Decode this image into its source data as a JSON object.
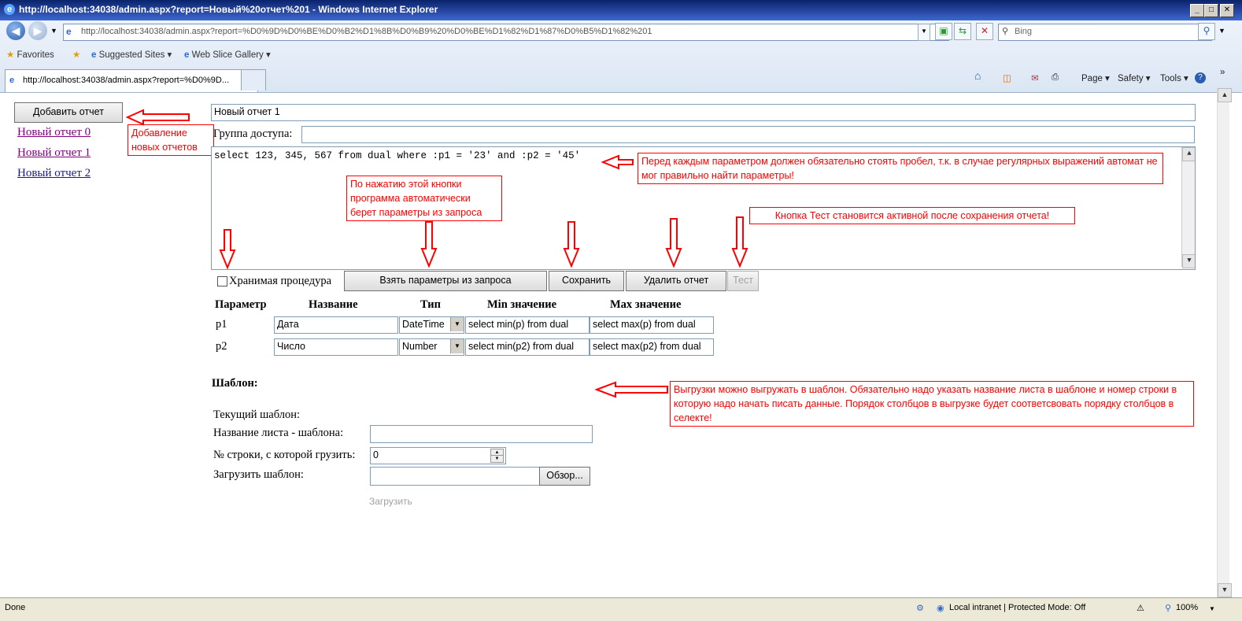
{
  "window": {
    "title": "http://localhost:34038/admin.aspx?report=Новый%20отчет%201 - Windows Internet Explorer"
  },
  "browser": {
    "address": "http://localhost:34038/admin.aspx?report=%D0%9D%D0%BE%D0%B2%D1%8B%D0%B9%20%D0%BE%D1%82%D1%87%D0%B5%D1%82%201",
    "search_placeholder": "Bing",
    "favorites_label": "Favorites",
    "suggested_sites": "Suggested Sites ▾",
    "web_slice": "Web Slice Gallery ▾",
    "tab_title": "http://localhost:34038/admin.aspx?report=%D0%9D...",
    "cmd_page": "Page ▾",
    "cmd_safety": "Safety ▾",
    "cmd_tools": "Tools ▾"
  },
  "sidebar": {
    "add_button": "Добавить отчет",
    "reports": [
      "Новый отчет 0",
      "Новый отчет 1",
      "Новый отчет 2"
    ],
    "note": "Добавление новых отчетов"
  },
  "report": {
    "name": "Новый отчет 1",
    "group_label": "Группа доступа:",
    "group_value": "",
    "sql": "select 123, 345, 567 from dual where :p1 = '23' and :p2 = '45'",
    "stored_proc_label": "Хранимая процедура",
    "btn_params": "Взять параметры из запроса",
    "btn_save": "Сохранить",
    "btn_delete": "Удалить отчет",
    "btn_test": "Тест"
  },
  "notes": {
    "sql_space": "Перед каждым параметром должен обязательно стоять пробел, т.к. в случае регулярных выражений автомат не мог правильно найти параметры!",
    "params_button": "По нажатию этой кнопки программа автоматически берет параметры из запроса",
    "test_button": "Кнопка Тест становится активной после сохранения отчета!",
    "template": "Выгрузки можно выгружать в шаблон. Обязательно надо указать название листа в шаблоне и номер строки в которую надо начать писать данные. Порядок столбцов в выгрузке будет соответсвовать порядку столбцов в селекте!"
  },
  "params": {
    "headers": [
      "Параметр",
      "Название",
      "Тип",
      "Min значение",
      "Max значение"
    ],
    "rows": [
      {
        "param": "p1",
        "name": "Дата",
        "type": "DateTime",
        "min": "select min(p) from dual",
        "max": "select max(p) from dual"
      },
      {
        "param": "p2",
        "name": "Число",
        "type": "Number",
        "min": "select min(p2) from dual",
        "max": "select max(p2) from dual"
      }
    ]
  },
  "template": {
    "title": "Шаблон:",
    "current_label": "Текущий шаблон:",
    "sheet_label": "Название листа - шаблона:",
    "sheet_value": "",
    "row_label": "№ строки, с которой грузить:",
    "row_value": "0",
    "upload_label": "Загрузить шаблон:",
    "browse": "Обзор...",
    "load": "Загрузить"
  },
  "status": {
    "left": "Done",
    "zone": "Local intranet | Protected Mode: Off",
    "zoom": "100%"
  },
  "colors": {
    "annotation": "#ff0000",
    "link_visited": "#800080",
    "link": "#1a1a8c"
  }
}
